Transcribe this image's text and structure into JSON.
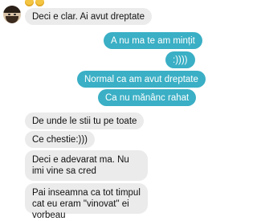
{
  "conversation": {
    "messages": [
      {
        "id": "m1",
        "direction": "incoming",
        "text": "Deci e clar. Ai avut dreptate"
      },
      {
        "id": "m2",
        "direction": "outgoing",
        "text": "A nu ma te am mințit"
      },
      {
        "id": "m3",
        "direction": "outgoing",
        "text": ":))))"
      },
      {
        "id": "m4",
        "direction": "outgoing",
        "text": "Normal ca am avut dreptate"
      },
      {
        "id": "m5",
        "direction": "outgoing",
        "text": "Ca nu mănânc rahat"
      },
      {
        "id": "m6",
        "direction": "incoming",
        "text": "De unde le stii tu pe toate"
      },
      {
        "id": "m7",
        "direction": "incoming",
        "text": "Ce chestie:)))"
      },
      {
        "id": "m8",
        "direction": "incoming",
        "text": "Deci e adevarat ma. Nu imi vine sa cred"
      },
      {
        "id": "m9",
        "direction": "incoming",
        "text": "Pai inseamna ca tot timpul cat eu eram \"vinovat\" ei vorbeau"
      }
    ],
    "top_emojis": [
      "grinning-face-icon",
      "grinning-face-icon"
    ]
  },
  "colors": {
    "incoming_bubble": "#ebebeb",
    "outgoing_bubble": "#3aafc5",
    "incoming_text": "#111111",
    "outgoing_text": "#ffffff"
  }
}
